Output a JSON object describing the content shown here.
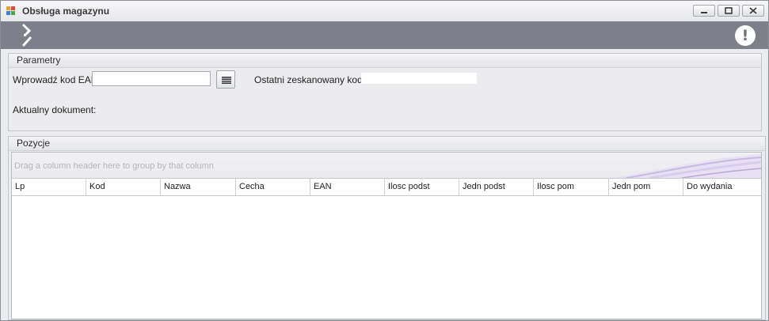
{
  "window": {
    "title": "Obsługa magazynu"
  },
  "parametry": {
    "title": "Parametry",
    "ean_label": "Wprowadź kod EAN",
    "ean_value": "",
    "last_scanned_label": "Ostatni zeskanowany kod:",
    "last_scanned_value": "",
    "current_document_label": "Aktualny dokument:",
    "current_document_value": ""
  },
  "pozycje": {
    "title": "Pozycje",
    "group_hint": "Drag a column header here to group by that column",
    "columns": [
      "Lp",
      "Kod",
      "Nazwa",
      "Cecha",
      "EAN",
      "Ilosc podst",
      "Jedn podst",
      "Ilosc pom",
      "Jedn pom",
      "Do wydania"
    ],
    "rows": []
  },
  "icons": {
    "app": "warehouse-app-icon",
    "logo": "chevron-logo-icon",
    "alert": "exclamation-alert-icon",
    "list": "list-icon",
    "minimize": "minimize-icon",
    "maximize": "maximize-icon",
    "close": "close-icon"
  },
  "colors": {
    "toolbar": "#7d7f8b",
    "accent_swoosh": "#b9a7dc"
  }
}
